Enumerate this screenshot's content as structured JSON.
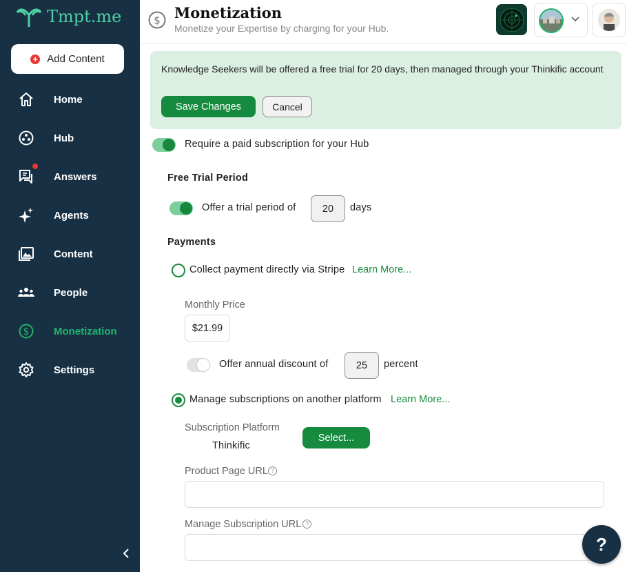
{
  "app": {
    "name": "Tmpt.me"
  },
  "sidebar": {
    "add_content": "Add Content",
    "items": [
      {
        "label": "Home",
        "icon": "home-icon"
      },
      {
        "label": "Hub",
        "icon": "hub-icon"
      },
      {
        "label": "Answers",
        "icon": "answers-icon",
        "notification": true
      },
      {
        "label": "Agents",
        "icon": "sparkle-icon"
      },
      {
        "label": "Content",
        "icon": "content-icon"
      },
      {
        "label": "People",
        "icon": "people-icon"
      },
      {
        "label": "Monetization",
        "icon": "dollar-icon",
        "active": true
      },
      {
        "label": "Settings",
        "icon": "gear-icon"
      }
    ]
  },
  "header": {
    "title": "Monetization",
    "subtitle": "Monetize your Expertise by charging for your Hub."
  },
  "banner": {
    "message": "Knowledge Seekers will be offered a free trial for 20 days, then managed through your Thinkific account",
    "save": "Save Changes",
    "cancel": "Cancel"
  },
  "form": {
    "require_paid": "Require a paid subscription for your Hub",
    "free_trial_heading": "Free Trial Period",
    "trial_prefix": "Offer a trial period of",
    "trial_days": "20",
    "trial_suffix": "days",
    "payments_heading": "Payments",
    "stripe_option": "Collect payment directly via Stripe",
    "learn_more": "Learn More...",
    "monthly_price_label": "Monthly Price",
    "monthly_price": "$21.99",
    "annual_prefix": "Offer annual discount of",
    "annual_percent": "25",
    "annual_suffix": "percent",
    "platform_option": "Manage subscriptions on another platform",
    "platform_label": "Subscription Platform",
    "platform_value": "Thinkific",
    "select_button": "Select...",
    "product_url_label": "Product Page URL",
    "manage_url_label": "Manage Subscription URL",
    "help_symbol": "?"
  },
  "fab": "?",
  "colors": {
    "sidebar": "#173044",
    "accent": "#168a3f",
    "banner": "#dcefe3"
  }
}
